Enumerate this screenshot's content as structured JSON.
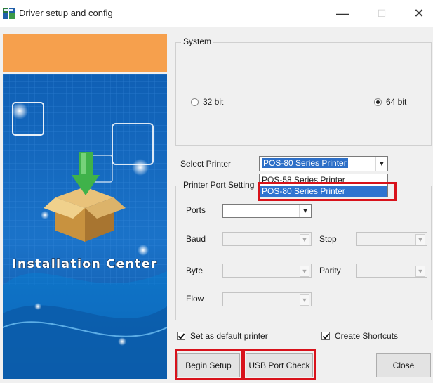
{
  "window": {
    "title": "Driver setup and config",
    "minimize_glyph": "—",
    "maximize_glyph": "☐",
    "close_glyph": "✕",
    "icon": "app-icon"
  },
  "art": {
    "label": "Installation Center",
    "banner_color": "#f6a04d",
    "background_color": "#1565b4",
    "icon": "box-download-icon"
  },
  "system": {
    "legend": "System",
    "options": [
      {
        "label": "32 bit",
        "selected": false
      },
      {
        "label": "64 bit",
        "selected": true
      }
    ]
  },
  "printer": {
    "select_label": "Select Printer",
    "selected_value": "POS-80 Series Printer",
    "dropdown_open": true,
    "options": [
      {
        "label": "POS-58 Series Printer",
        "highlighted": false
      },
      {
        "label": "POS-80 Series Printer",
        "highlighted": true
      }
    ]
  },
  "port_settings": {
    "legend": "Printer Port Setting",
    "ports_label": "Ports",
    "ports_value": "",
    "baud_label": "Baud",
    "stop_label": "Stop",
    "byte_label": "Byte",
    "parity_label": "Parity",
    "flow_label": "Flow"
  },
  "options": {
    "default_printer_label": "Set as default printer",
    "default_printer_checked": true,
    "shortcuts_label": "Create Shortcuts",
    "shortcuts_checked": true
  },
  "buttons": {
    "begin_setup": "Begin Setup",
    "usb_port_check": "USB Port Check",
    "close": "Close"
  },
  "highlight_color": "#d8121b"
}
